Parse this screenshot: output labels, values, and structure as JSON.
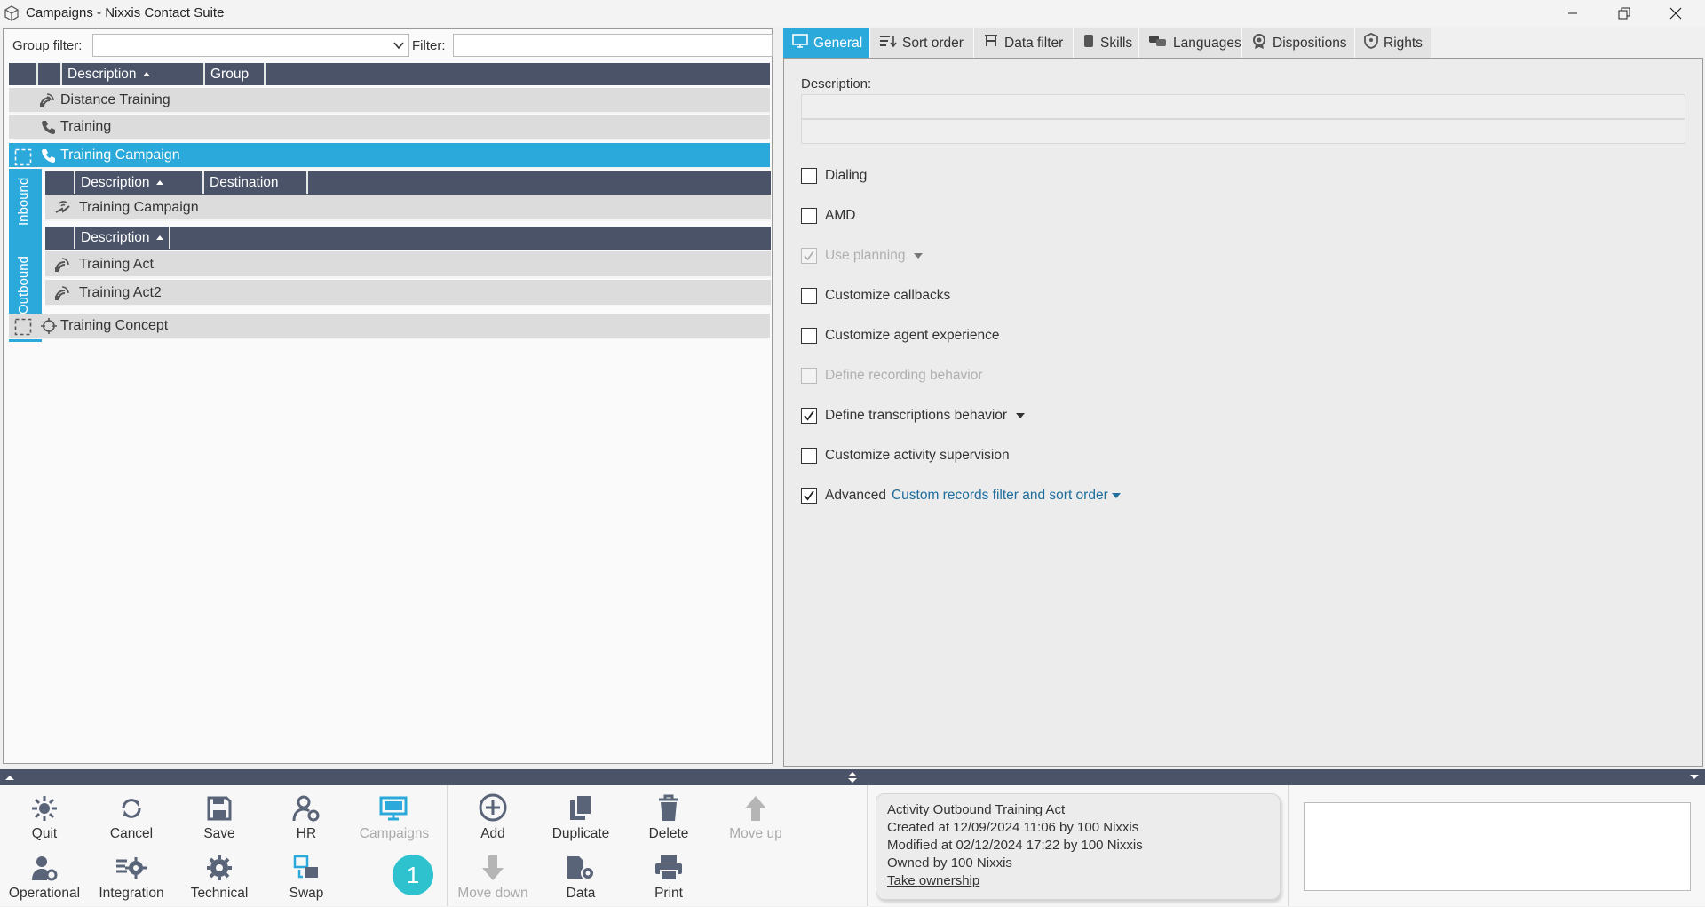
{
  "window": {
    "title": "Campaigns - Nixxis Contact Suite"
  },
  "filters": {
    "group_label": "Group filter:",
    "group_value": "",
    "filter_label": "Filter:",
    "filter_value": ""
  },
  "campaign_grid": {
    "headers": [
      "Description",
      "Group"
    ],
    "rows": [
      {
        "label": "Distance Training",
        "icon": "outbound-icon"
      },
      {
        "label": "Training",
        "icon": "phone-icon"
      },
      {
        "label": "Training Campaign",
        "icon": "phone-icon",
        "selected": true
      },
      {
        "label": "Training Concept",
        "icon": "crosshair-icon"
      }
    ]
  },
  "side_tabs": {
    "inbound": "Inbound",
    "outbound": "Outbound"
  },
  "inbound_grid": {
    "headers": [
      "Description",
      "Destination"
    ],
    "rows": [
      {
        "label": "Training Campaign",
        "icon": "inbound-icon"
      }
    ]
  },
  "outbound_grid": {
    "headers": [
      "Description"
    ],
    "rows": [
      {
        "label": "Training Act",
        "icon": "outbound-icon"
      },
      {
        "label": "Training Act2",
        "icon": "outbound-icon"
      }
    ]
  },
  "tabs": [
    {
      "label": "General",
      "icon": "monitor-icon",
      "active": true
    },
    {
      "label": "Sort order",
      "icon": "sort-icon"
    },
    {
      "label": "Data filter",
      "icon": "filter-icon"
    },
    {
      "label": "Skills",
      "icon": "skills-icon"
    },
    {
      "label": "Languages",
      "icon": "languages-icon"
    },
    {
      "label": "Dispositions",
      "icon": "dispositions-icon"
    },
    {
      "label": "Rights",
      "icon": "shield-icon"
    }
  ],
  "general": {
    "description_label": "Description:",
    "description_value": "",
    "options": [
      {
        "label": "Dialing",
        "checked": false,
        "enabled": true,
        "dropdown": false
      },
      {
        "label": "AMD",
        "checked": false,
        "enabled": true,
        "dropdown": false
      },
      {
        "label": "Use planning",
        "checked": true,
        "enabled": false,
        "dropdown": true
      },
      {
        "label": "Customize callbacks",
        "checked": false,
        "enabled": true,
        "dropdown": false
      },
      {
        "label": "Customize agent experience",
        "checked": false,
        "enabled": true,
        "dropdown": false
      },
      {
        "label": "Define recording behavior",
        "checked": false,
        "enabled": false,
        "dropdown": false
      },
      {
        "label": "Define transcriptions behavior",
        "checked": true,
        "enabled": true,
        "dropdown": true
      },
      {
        "label": "Customize activity supervision",
        "checked": false,
        "enabled": true,
        "dropdown": false
      },
      {
        "label": "Advanced",
        "checked": true,
        "enabled": true,
        "dropdown": true,
        "link": "Custom records filter and sort order"
      }
    ]
  },
  "toolbar": {
    "row1": [
      {
        "label": "Quit",
        "icon": "quit-icon"
      },
      {
        "label": "Cancel",
        "icon": "cancel-icon"
      },
      {
        "label": "Save",
        "icon": "save-icon"
      },
      {
        "label": "HR",
        "icon": "hr-icon"
      },
      {
        "label": "Campaigns",
        "icon": "campaigns-icon",
        "disabled": true
      },
      {
        "label": "Add",
        "icon": "add-icon"
      },
      {
        "label": "Duplicate",
        "icon": "duplicate-icon"
      },
      {
        "label": "Delete",
        "icon": "delete-icon"
      },
      {
        "label": "Move up",
        "icon": "move-up-icon",
        "disabled": true
      }
    ],
    "row2": [
      {
        "label": "Operational",
        "icon": "operational-icon"
      },
      {
        "label": "Integration",
        "icon": "integration-icon"
      },
      {
        "label": "Technical",
        "icon": "technical-icon"
      },
      {
        "label": "Swap",
        "icon": "swap-icon"
      },
      {
        "label": "Move down",
        "icon": "move-down-icon",
        "disabled": true
      },
      {
        "label": "Data",
        "icon": "data-icon"
      },
      {
        "label": "Print",
        "icon": "print-icon"
      }
    ],
    "badge": "1"
  },
  "info": {
    "line1": "Activity Outbound Training Act",
    "line2": "Created at 12/09/2024 11:06 by 100 Nixxis",
    "line3": "Modified at 02/12/2024 17:22 by 100 Nixxis",
    "line4": "Owned by 100 Nixxis",
    "link": "Take ownership"
  },
  "colors": {
    "accent": "#2aa9da",
    "header": "#4a5368",
    "row": "#dcdcdc",
    "badge": "#2ec2cf"
  }
}
